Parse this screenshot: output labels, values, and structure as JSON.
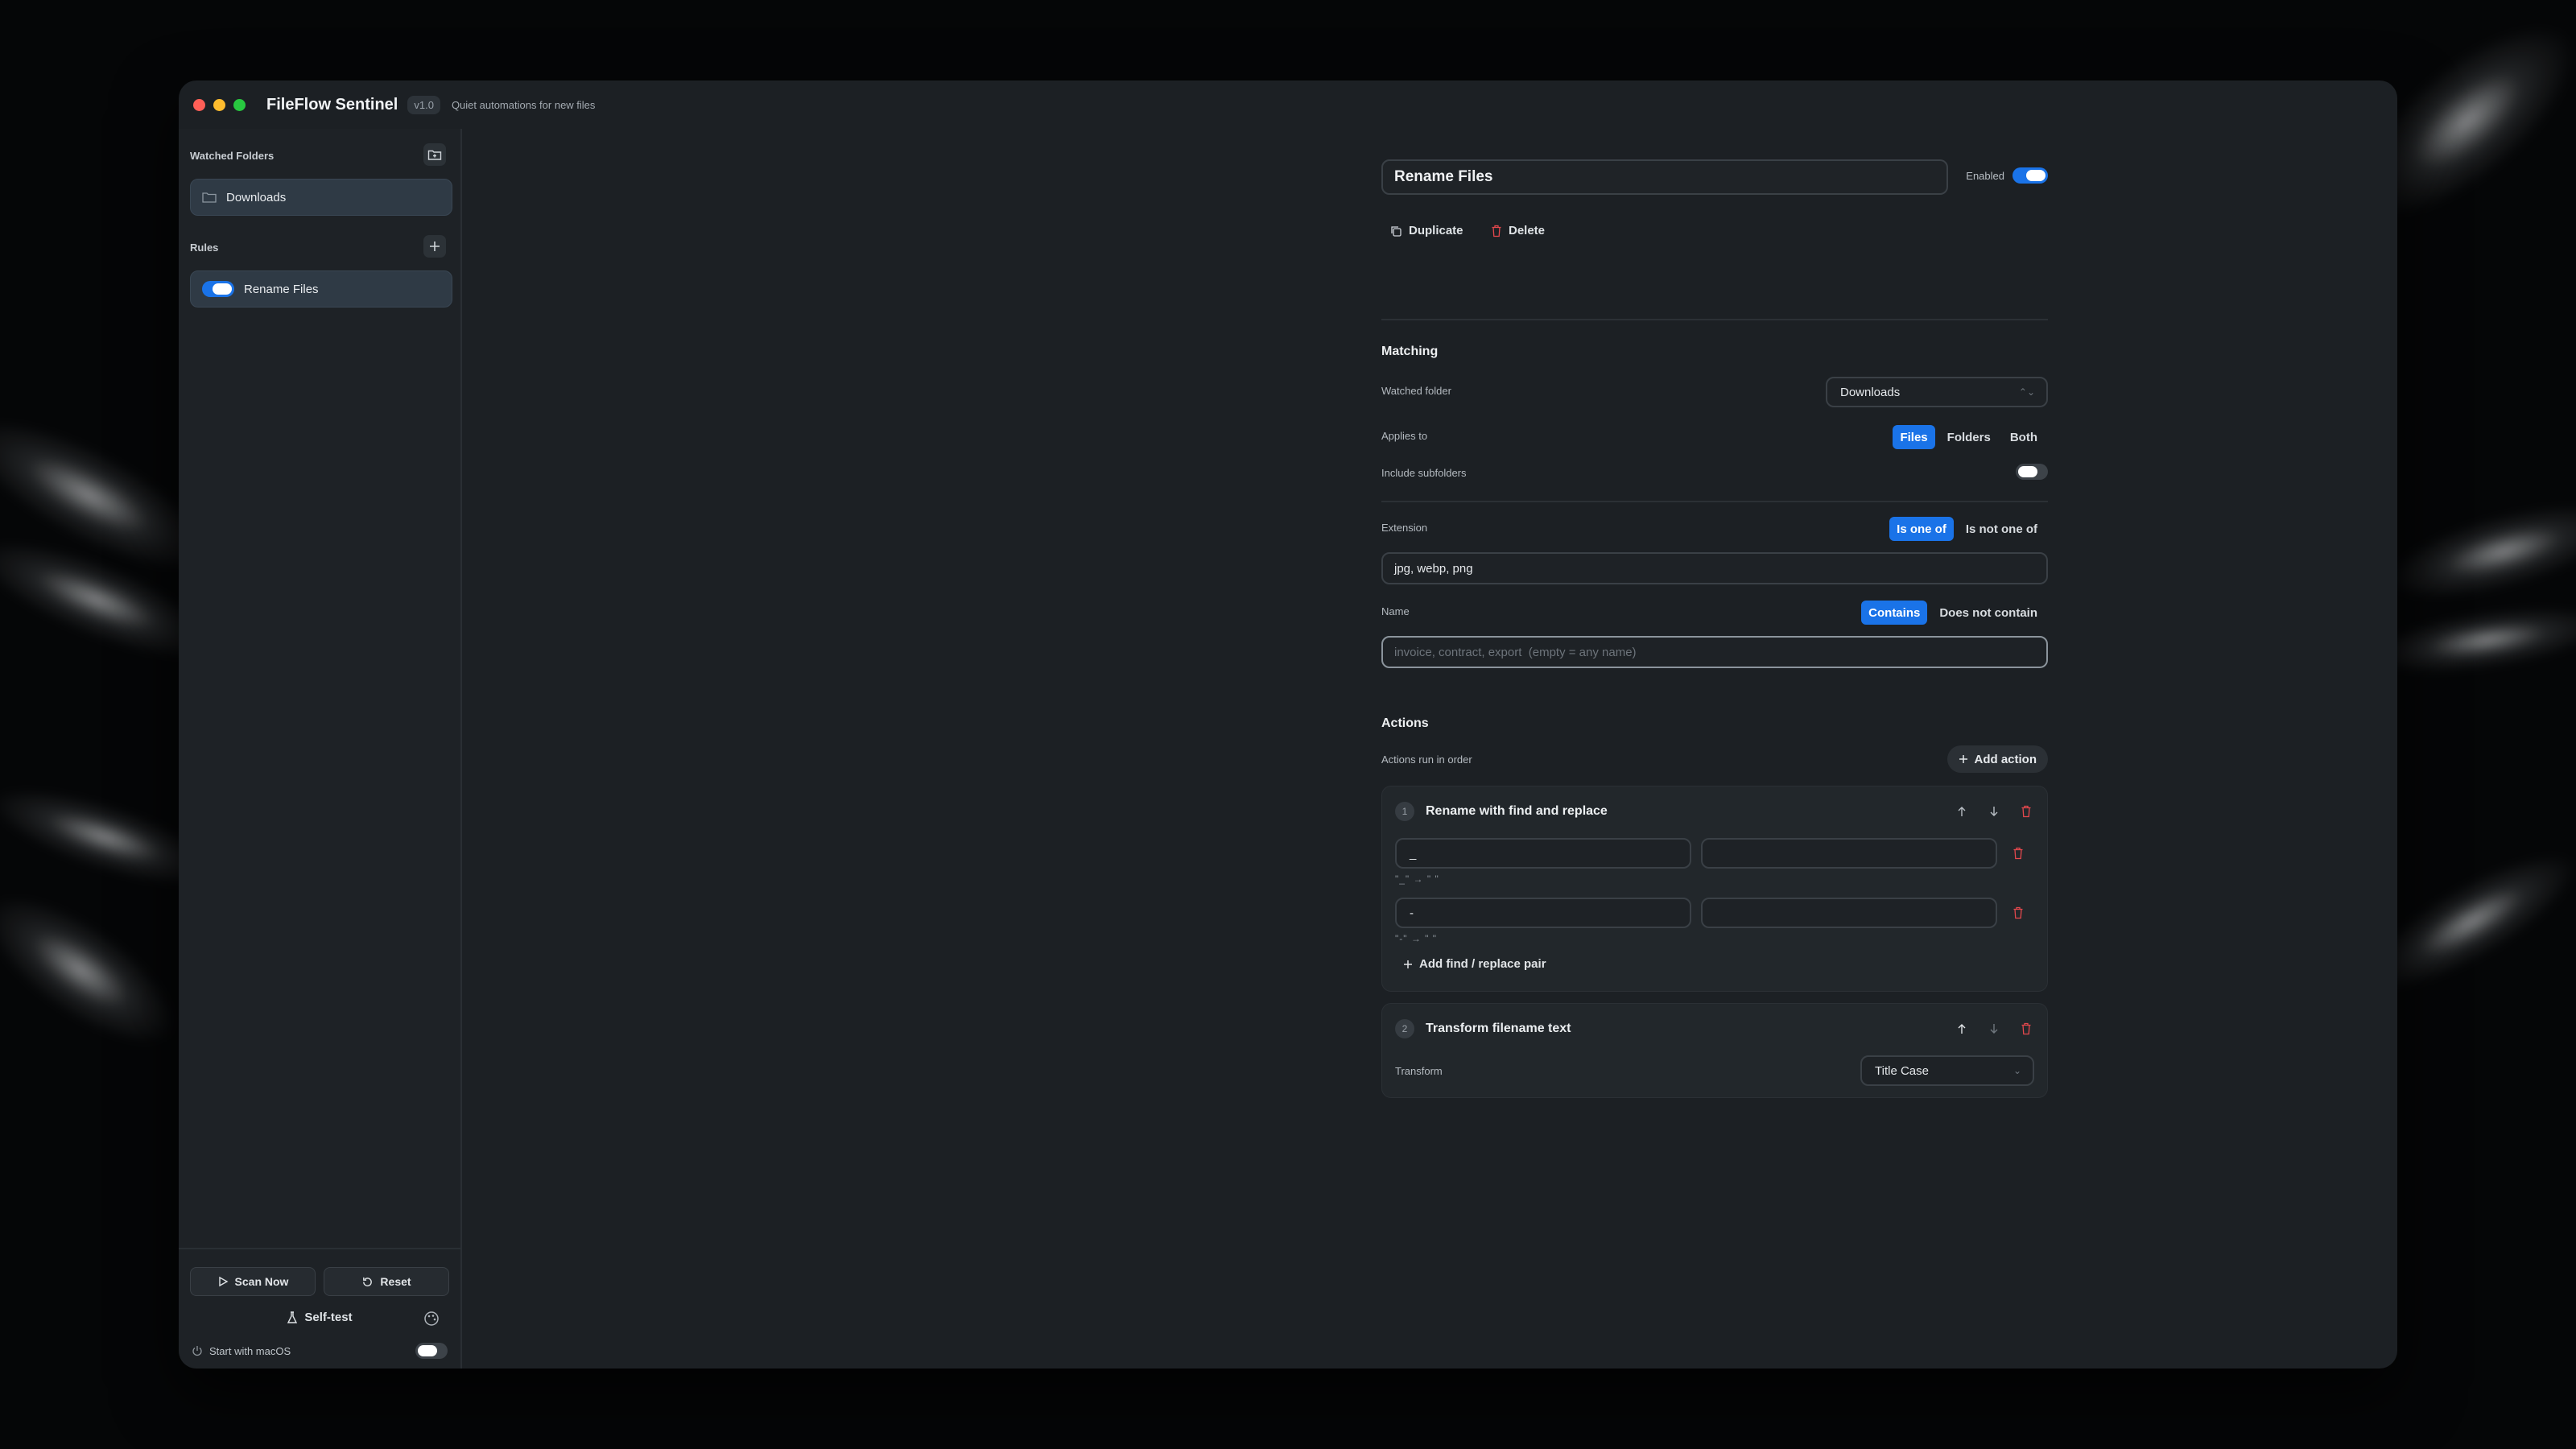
{
  "app": {
    "title": "FileFlow Sentinel",
    "version": "v1.0",
    "tagline": "Quiet automations for new files"
  },
  "sidebar": {
    "watched_folders_title": "Watched Folders",
    "folders": [
      {
        "label": "Downloads"
      }
    ],
    "rules_title": "Rules",
    "rules": [
      {
        "label": "Rename Files",
        "enabled": true
      }
    ],
    "scan_label": "Scan Now",
    "reset_label": "Reset",
    "self_test_label": "Self-test",
    "start_with_macos_label": "Start with macOS",
    "start_with_macos": false
  },
  "rule": {
    "name": "Rename Files",
    "enabled_label": "Enabled",
    "enabled": true,
    "duplicate_label": "Duplicate",
    "delete_label": "Delete"
  },
  "matching": {
    "title": "Matching",
    "watched_folder_label": "Watched folder",
    "watched_folder_value": "Downloads",
    "applies_to_label": "Applies to",
    "applies_to_options": [
      "Files",
      "Folders",
      "Both"
    ],
    "applies_to_selected": "Files",
    "include_subfolders_label": "Include subfolders",
    "include_subfolders": false,
    "extension_label": "Extension",
    "extension_modes": [
      "Is one of",
      "Is not one of"
    ],
    "extension_mode_selected": "Is one of",
    "extension_value": "jpg, webp, png",
    "name_label": "Name",
    "name_modes": [
      "Contains",
      "Does not contain"
    ],
    "name_mode_selected": "Contains",
    "name_value": "",
    "name_placeholder": "invoice, contract, export  (empty = any name)"
  },
  "actions": {
    "title": "Actions",
    "subtitle": "Actions run in order",
    "add_action_label": "Add action",
    "items": [
      {
        "number": "1",
        "title": "Rename with find and replace",
        "pairs": [
          {
            "find": "_",
            "replace": "",
            "hint": "\"_\" → \" \""
          },
          {
            "find": "-",
            "replace": "",
            "hint": "\"-\" → \" \""
          }
        ],
        "add_pair_label": "Add find / replace pair"
      },
      {
        "number": "2",
        "title": "Transform filename text",
        "transform_label": "Transform",
        "transform_value": "Title Case"
      }
    ]
  },
  "colors": {
    "accent": "#1a73e8",
    "danger": "#e5484d",
    "window_bg": "#1c2024",
    "traffic_red": "#ff5f57",
    "traffic_yellow": "#febc2e",
    "traffic_green": "#28c840"
  },
  "icons": {
    "folder": "folder-icon",
    "add_folder": "folder-plus-icon",
    "add_rule": "plus-icon",
    "duplicate": "copy-icon",
    "delete": "trash-icon",
    "scan": "play-icon",
    "reset": "rotate-icon",
    "self_test": "flask-icon",
    "palette": "palette-icon",
    "power": "power-icon",
    "move_up": "arrow-up-icon",
    "move_down": "arrow-down-icon"
  }
}
